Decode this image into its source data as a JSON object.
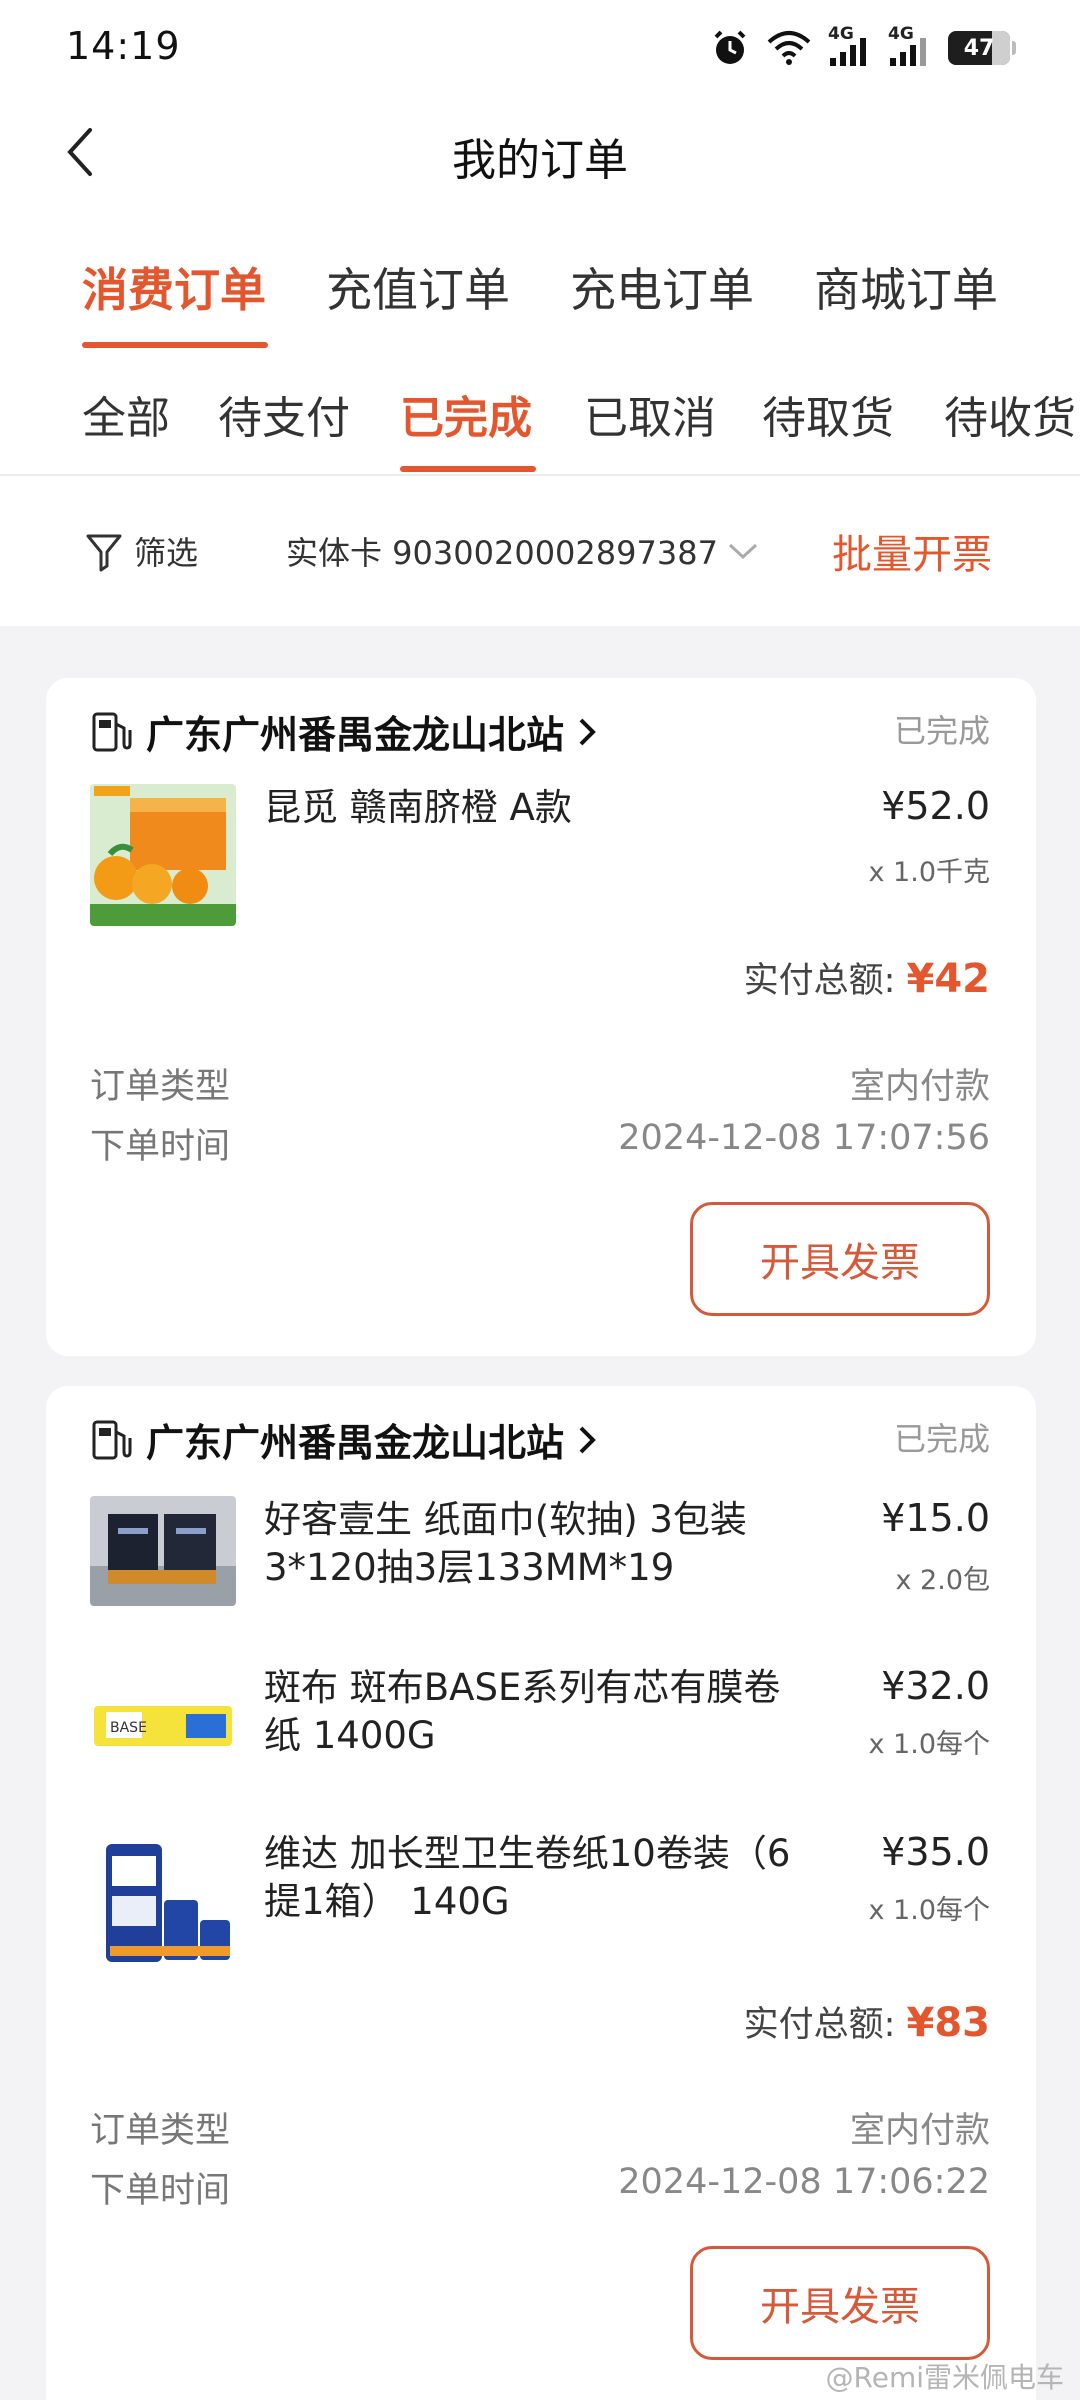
{
  "status_bar": {
    "time": "14:19",
    "battery": "47",
    "signal1": "4G",
    "signal2": "4G"
  },
  "navbar": {
    "title": "我的订单"
  },
  "order_tabs": [
    {
      "label": "消费订单",
      "active": true
    },
    {
      "label": "充值订单",
      "active": false
    },
    {
      "label": "充电订单",
      "active": false
    },
    {
      "label": "商城订单",
      "active": false
    }
  ],
  "status_tabs": [
    {
      "label": "全部"
    },
    {
      "label": "待支付"
    },
    {
      "label": "已完成",
      "active": true
    },
    {
      "label": "已取消"
    },
    {
      "label": "待取货"
    },
    {
      "label": "待收货"
    }
  ],
  "filter": {
    "label": "筛选",
    "card": "实体卡 9030020002897387",
    "batch_invoice": "批量开票"
  },
  "orders": [
    {
      "station": "广东广州番禺金龙山北站",
      "status": "已完成",
      "items": [
        {
          "name": "昆觅 赣南脐橙 A款",
          "price": "¥52.0",
          "qty": "x 1.0千克"
        }
      ],
      "total_label": "实付总额:",
      "total_value": "¥42",
      "type_label": "订单类型",
      "type_value": "室内付款",
      "time_label": "下单时间",
      "time_value": "2024-12-08 17:07:56",
      "invoice_button": "开具发票"
    },
    {
      "station": "广东广州番禺金龙山北站",
      "status": "已完成",
      "items": [
        {
          "name": "好客壹生 纸面巾(软抽) 3包装3*120抽3层133MM*19",
          "price": "¥15.0",
          "qty": "x 2.0包"
        },
        {
          "name": "斑布 斑布BASE系列有芯有膜卷纸 1400G",
          "price": "¥32.0",
          "qty": "x 1.0每个"
        },
        {
          "name": "维达 加长型卫生卷纸10卷装（6提1箱） 140G",
          "price": "¥35.0",
          "qty": "x 1.0每个"
        }
      ],
      "total_label": "实付总额:",
      "total_value": "¥83",
      "type_label": "订单类型",
      "type_value": "室内付款",
      "time_label": "下单时间",
      "time_value": "2024-12-08 17:06:22",
      "invoice_button": "开具发票"
    }
  ],
  "watermark": "@Remi雷米佩电车",
  "colors": {
    "accent": "#e4572e",
    "background": "#f3f3f5",
    "card": "#ffffff"
  }
}
